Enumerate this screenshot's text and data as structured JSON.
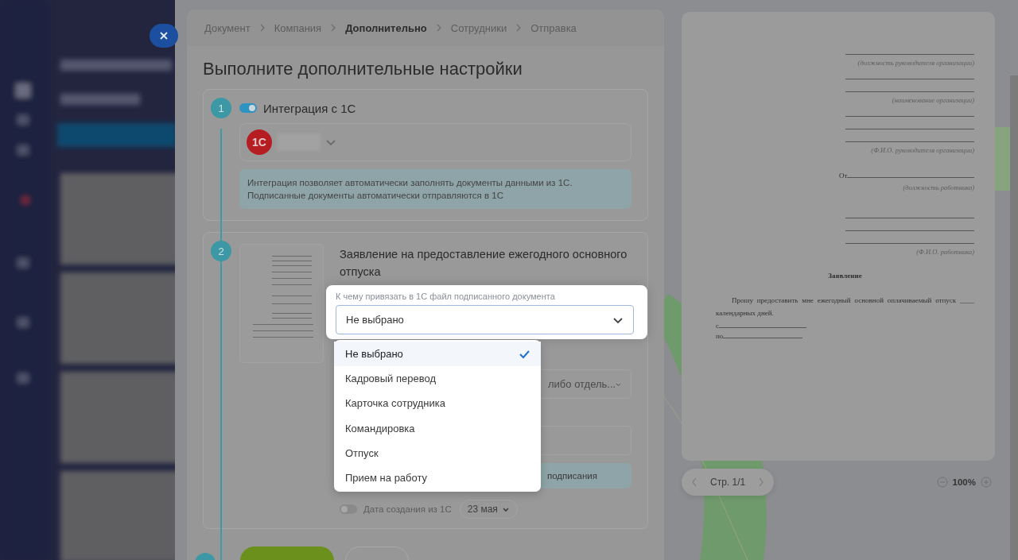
{
  "breadcrumbs": [
    {
      "label": "Документ",
      "selected": false
    },
    {
      "label": "Компания",
      "selected": false
    },
    {
      "label": "Дополнительно",
      "selected": true
    },
    {
      "label": "Сотрудники",
      "selected": false
    },
    {
      "label": "Отправка",
      "selected": false
    }
  ],
  "heading": "Выполните дополнительные настройки",
  "integration": {
    "step": "1",
    "on": true,
    "title": "Интеграция с 1С",
    "logo": "1С",
    "info_lines": [
      "Интеграция позволяет автоматически заполнять документы данными из 1С.",
      "Подписанные документы автоматически отправляются в 1С"
    ]
  },
  "document": {
    "step": "2",
    "title": "Заявление на предоставление ежегодного основного отпуска",
    "binding": {
      "label": "К чему привязать в 1С файл подписанного документа",
      "value": "Не выбрано",
      "expanded": true,
      "options": [
        {
          "label": "Не выбрано",
          "selected": true
        },
        {
          "label": "Кадровый перевод",
          "selected": false
        },
        {
          "label": "Карточка сотрудника",
          "selected": false
        },
        {
          "label": "Командировка",
          "selected": false
        },
        {
          "label": "Отпуск",
          "selected": false
        },
        {
          "label": "Прием на работу",
          "selected": false
        }
      ]
    },
    "department_value": "либо отдель...",
    "hint": "подписания",
    "date_toggle": {
      "on": false,
      "label": "Дата создания из 1С",
      "value": "23 мая"
    }
  },
  "preview": {
    "items": [
      {
        "kind": "blank"
      },
      {
        "kind": "caption",
        "text": "(должность руководителя организации)"
      },
      {
        "kind": "blank"
      },
      {
        "kind": "blank"
      },
      {
        "kind": "caption",
        "text": "(наименование организации)"
      },
      {
        "kind": "blank"
      },
      {
        "kind": "blank"
      },
      {
        "kind": "blank"
      },
      {
        "kind": "caption",
        "text": "(Ф.И.О. руководителя организации)"
      },
      {
        "kind": "from",
        "text": "От"
      },
      {
        "kind": "caption",
        "text": "(должность работника)"
      },
      {
        "kind": "space"
      },
      {
        "kind": "blank"
      },
      {
        "kind": "blank"
      },
      {
        "kind": "blank"
      },
      {
        "kind": "caption",
        "text": "(Ф.И.О. работника)"
      },
      {
        "kind": "title",
        "text": "Заявление"
      },
      {
        "kind": "paragraph",
        "text": "Прошу предоставить мне ежегодный основной оплачиваемый отпуск ____ календарных дней."
      },
      {
        "kind": "date",
        "text": "с"
      },
      {
        "kind": "date",
        "text": "по"
      }
    ],
    "page": "Стр. 1/1",
    "zoom": "100%"
  }
}
